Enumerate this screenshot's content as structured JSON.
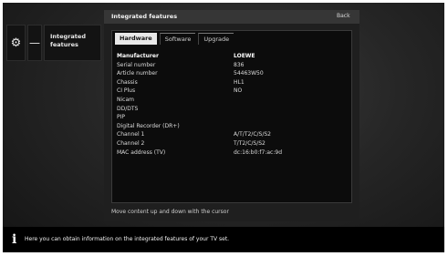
{
  "sidebar": {
    "gear_icon": "gear-icon",
    "dash_label": "—",
    "item_line1": "Integrated",
    "item_line2": "features"
  },
  "dialog": {
    "title": "Integrated features",
    "back_label": "Back",
    "tabs": [
      {
        "label": "Hardware",
        "active": true
      },
      {
        "label": "Software",
        "active": false
      },
      {
        "label": "Upgrade",
        "active": false
      }
    ],
    "rows": [
      {
        "label": "Manufacturer",
        "value": "LOEWE"
      },
      {
        "label": "Serial number",
        "value": "836"
      },
      {
        "label": "Article number",
        "value": "54463W50"
      },
      {
        "label": "Chassis",
        "value": "HL1"
      },
      {
        "label": "CI Plus",
        "value": "NO"
      },
      {
        "label": "Nicam",
        "value": ""
      },
      {
        "label": "DD/DTS",
        "value": ""
      },
      {
        "label": "PIP",
        "value": ""
      },
      {
        "label": "Digital Recorder (DR+)",
        "value": ""
      },
      {
        "label": "Channel 1",
        "value": "A/T/T2/C/S/S2"
      },
      {
        "label": "Channel 2",
        "value": "T/T2/C/S/S2"
      },
      {
        "label": "MAC address (TV)",
        "value": "dc:16:b0:f7:ac:9d"
      }
    ],
    "hint": "Move content up and down with the cursor"
  },
  "info": {
    "icon": "info-icon",
    "text": "Here you can obtain information on the integrated features of your TV set."
  }
}
